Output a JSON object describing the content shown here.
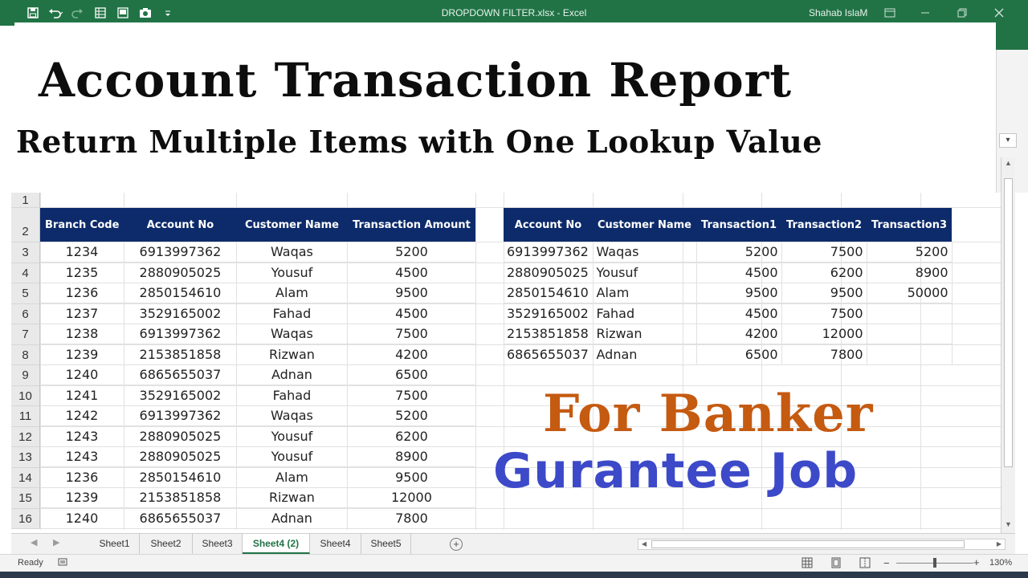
{
  "window": {
    "file_title": "DROPDOWN FILTER.xlsx",
    "app_name": "Excel",
    "title_sep": " - ",
    "user": "Shahab IslaM"
  },
  "banner": {
    "title": "Account Transaction Report",
    "subtitle": "Return Multiple Items with One Lookup Value"
  },
  "row_numbers": [
    "1",
    "2",
    "3",
    "4",
    "5",
    "6",
    "7",
    "8",
    "9",
    "10",
    "11",
    "12",
    "13",
    "14",
    "15",
    "16"
  ],
  "left_table": {
    "headers": [
      "Branch Code",
      "Account No",
      "Customer Name",
      "Transaction Amount"
    ],
    "rows": [
      [
        "1234",
        "6913997362",
        "Waqas",
        "5200"
      ],
      [
        "1235",
        "2880905025",
        "Yousuf",
        "4500"
      ],
      [
        "1236",
        "2850154610",
        "Alam",
        "9500"
      ],
      [
        "1237",
        "3529165002",
        "Fahad",
        "4500"
      ],
      [
        "1238",
        "6913997362",
        "Waqas",
        "7500"
      ],
      [
        "1239",
        "2153851858",
        "Rizwan",
        "4200"
      ],
      [
        "1240",
        "6865655037",
        "Adnan",
        "6500"
      ],
      [
        "1241",
        "3529165002",
        "Fahad",
        "7500"
      ],
      [
        "1242",
        "6913997362",
        "Waqas",
        "5200"
      ],
      [
        "1243",
        "2880905025",
        "Yousuf",
        "6200"
      ],
      [
        "1243",
        "2880905025",
        "Yousuf",
        "8900"
      ],
      [
        "1236",
        "2850154610",
        "Alam",
        "9500"
      ],
      [
        "1239",
        "2153851858",
        "Rizwan",
        "12000"
      ],
      [
        "1240",
        "6865655037",
        "Adnan",
        "7800"
      ]
    ]
  },
  "right_table": {
    "headers": [
      "Account No",
      "Customer Name",
      "Transaction1",
      "Transaction2",
      "Transaction3"
    ],
    "rows": [
      [
        "6913997362",
        "Waqas",
        "5200",
        "7500",
        "5200"
      ],
      [
        "2880905025",
        "Yousuf",
        "4500",
        "6200",
        "8900"
      ],
      [
        "2850154610",
        "Alam",
        "9500",
        "9500",
        "50000"
      ],
      [
        "3529165002",
        "Fahad",
        "4500",
        "7500",
        ""
      ],
      [
        "2153851858",
        "Rizwan",
        "4200",
        "12000",
        ""
      ],
      [
        "6865655037",
        "Adnan",
        "6500",
        "7800",
        ""
      ]
    ]
  },
  "promo": {
    "line1": "For Banker",
    "line2": "Gurantee Job"
  },
  "sheet_tabs": [
    {
      "label": "Sheet1",
      "active": false
    },
    {
      "label": "Sheet2",
      "active": false
    },
    {
      "label": "Sheet3",
      "active": false
    },
    {
      "label": "Sheet4 (2)",
      "active": true
    },
    {
      "label": "Sheet4",
      "active": false
    },
    {
      "label": "Sheet5",
      "active": false
    }
  ],
  "status": {
    "ready": "Ready",
    "zoom": "130%"
  },
  "colors": {
    "excel_green": "#217346",
    "header_navy": "#0d2b6b",
    "promo_orange": "#c55a11",
    "promo_blue": "#3c49c8"
  }
}
